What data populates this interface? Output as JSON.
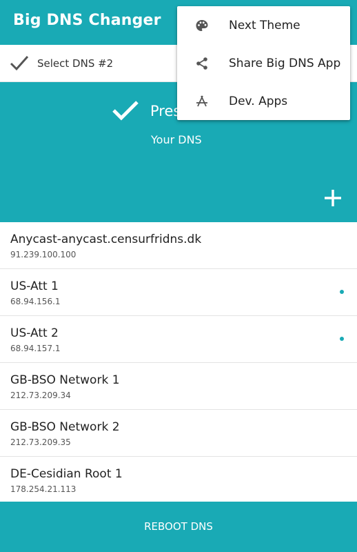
{
  "appbar": {
    "title": "Big DNS Changer"
  },
  "select_bar": {
    "label": "Select DNS #2"
  },
  "hero": {
    "title": "Pres",
    "subtitle": "Your DNS"
  },
  "dns_list": [
    {
      "name": "Anycast-anycast.censurfridns.dk",
      "ip": "91.239.100.100",
      "indicator": false
    },
    {
      "name": "US-Att 1",
      "ip": "68.94.156.1",
      "indicator": true
    },
    {
      "name": "US-Att 2",
      "ip": "68.94.157.1",
      "indicator": true
    },
    {
      "name": "GB-BSO Network 1",
      "ip": "212.73.209.34",
      "indicator": false
    },
    {
      "name": "GB-BSO Network 2",
      "ip": "212.73.209.35",
      "indicator": false
    },
    {
      "name": "DE-Cesidian Root 1",
      "ip": "178.254.21.113",
      "indicator": false
    }
  ],
  "footer": {
    "reboot_label": "REBOOT DNS"
  },
  "overflow_menu": {
    "items": [
      {
        "label": "Next Theme",
        "icon": "palette-icon"
      },
      {
        "label": "Share Big DNS App",
        "icon": "share-icon"
      },
      {
        "label": "Dev. Apps",
        "icon": "app-store-icon"
      }
    ]
  },
  "colors": {
    "primary": "#19aab5",
    "surface": "#ffffff",
    "divider": "#e3e3e3"
  }
}
